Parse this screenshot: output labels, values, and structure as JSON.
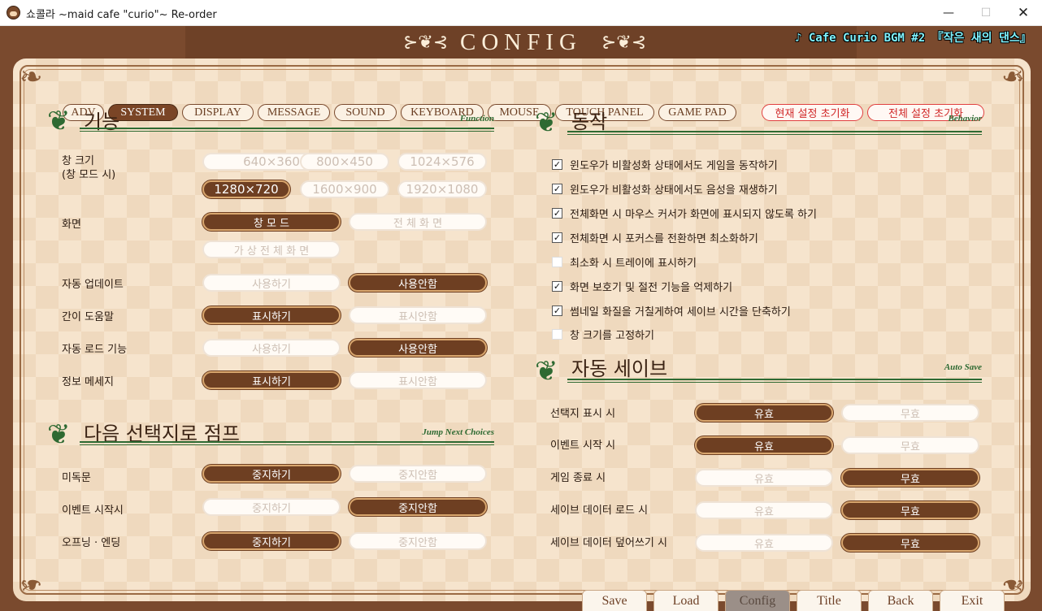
{
  "window": {
    "title": "쇼콜라 ~maid cafe \"curio\"~ Re-order",
    "min": "—",
    "max": "☐",
    "close": "✕"
  },
  "header": {
    "title": "CONFIG",
    "bgm": "♪ Cafe Curio BGM #2 『작은 새의 댄스』"
  },
  "tabs": [
    {
      "label": "ADV"
    },
    {
      "label": "SYSTEM"
    },
    {
      "label": "DISPLAY"
    },
    {
      "label": "MESSAGE"
    },
    {
      "label": "SOUND"
    },
    {
      "label": "KEYBOARD"
    },
    {
      "label": "MOUSE"
    },
    {
      "label": "TOUCH PANEL"
    },
    {
      "label": "GAME PAD"
    }
  ],
  "reset": {
    "current": "현재 설정 초기화",
    "all": "전체 설정 초기화"
  },
  "function": {
    "title": "기능",
    "title_en": "Function",
    "window_size": {
      "label": "창 크기\n(창 모드 시)",
      "options": [
        "640×360",
        "800×450",
        "1024×576",
        "1280×720",
        "1600×900",
        "1920×1080"
      ]
    },
    "screen": {
      "label": "화면",
      "options": [
        "창 모 드",
        "전 체 화 면",
        "가 상 전 체 화 면"
      ]
    },
    "auto_update": {
      "label": "자동 업데이트",
      "options": [
        "사용하기",
        "사용안함"
      ]
    },
    "tooltips": {
      "label": "간이 도움말",
      "options": [
        "표시하기",
        "표시안함"
      ]
    },
    "auto_load": {
      "label": "자동 로드 기능",
      "options": [
        "사용하기",
        "사용안함"
      ]
    },
    "info_message": {
      "label": "정보 메세지",
      "options": [
        "표시하기",
        "표시안함"
      ]
    }
  },
  "jump": {
    "title": "다음 선택지로 점프",
    "title_en": "Jump Next Choices",
    "unread": {
      "label": "미독문",
      "options": [
        "중지하기",
        "중지안함"
      ]
    },
    "event_start": {
      "label": "이벤트 시작시",
      "options": [
        "중지하기",
        "중지안함"
      ]
    },
    "op_ed": {
      "label": "오프닝 · 엔딩",
      "options": [
        "중지하기",
        "중지안함"
      ]
    }
  },
  "behavior": {
    "title": "동작",
    "title_en": "Behavior",
    "items": [
      {
        "label": "윈도우가 비활성화 상태에서도 게임을 동작하기",
        "mark": "✓"
      },
      {
        "label": "윈도우가 비활성화 상태에서도 음성을 재생하기",
        "mark": "✓"
      },
      {
        "label": "전체화면 시 마우스 커서가 화면에 표시되지 않도록 하기",
        "mark": "✓"
      },
      {
        "label": "전체화면 시 포커스를 전환하면 최소화하기",
        "mark": "✓"
      },
      {
        "label": "최소화 시 트레이에 표시하기",
        "mark": ""
      },
      {
        "label": "화면 보호기 및 절전 기능을 억제하기",
        "mark": "✓"
      },
      {
        "label": "썸네일 화질을 거칠게하여 세이브 시간을 단축하기",
        "mark": "✓"
      },
      {
        "label": "창 크기를 고정하기",
        "mark": ""
      }
    ]
  },
  "autosave": {
    "title": "자동 세이브",
    "title_en": "Auto Save",
    "rows": [
      {
        "label": "선택지 표시 시",
        "on": "유효",
        "off": "무효"
      },
      {
        "label": "이벤트 시작 시",
        "on": "유효",
        "off": "무효"
      },
      {
        "label": "게임 종료 시",
        "on": "유효",
        "off": "무효"
      },
      {
        "label": "세이브 데이터 로드 시",
        "on": "유효",
        "off": "무효"
      },
      {
        "label": "세이브 데이터 덮어쓰기 시",
        "on": "유효",
        "off": "무효"
      }
    ]
  },
  "nav": {
    "save": "Save",
    "load": "Load",
    "config": "Config",
    "title": "Title",
    "back": "Back",
    "exit": "Exit"
  },
  "colors": {
    "selected": "#6e3f22",
    "unselected": "#fffbf6",
    "accent_green": "#2e6a32",
    "reset_red": "#d02828",
    "bgm_cyan": "#7ff3ff"
  }
}
